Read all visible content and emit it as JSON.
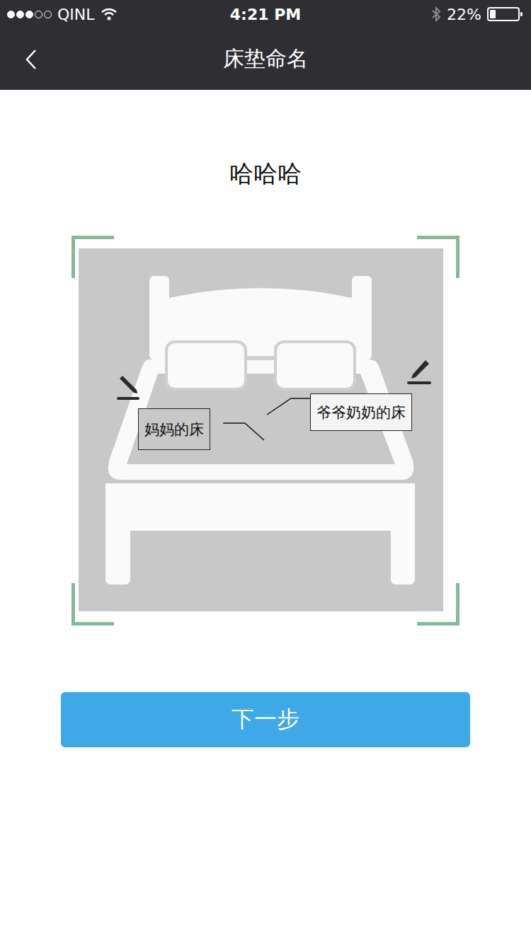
{
  "status_bar": {
    "carrier": "QINL",
    "time": "4:21 PM",
    "battery": "22%",
    "battery_level": 0.22,
    "signal_filled": 3,
    "signal_total": 5,
    "wifi": true,
    "bluetooth": true
  },
  "nav_bar": {
    "title": "床垫命名"
  },
  "mattress_name": "哈哈哈",
  "bed_sides": [
    {
      "label": "妈妈的床",
      "kind": "left"
    },
    {
      "label": "爷爷奶奶的床",
      "kind": "right"
    }
  ],
  "buttons": [
    "下一步"
  ]
}
